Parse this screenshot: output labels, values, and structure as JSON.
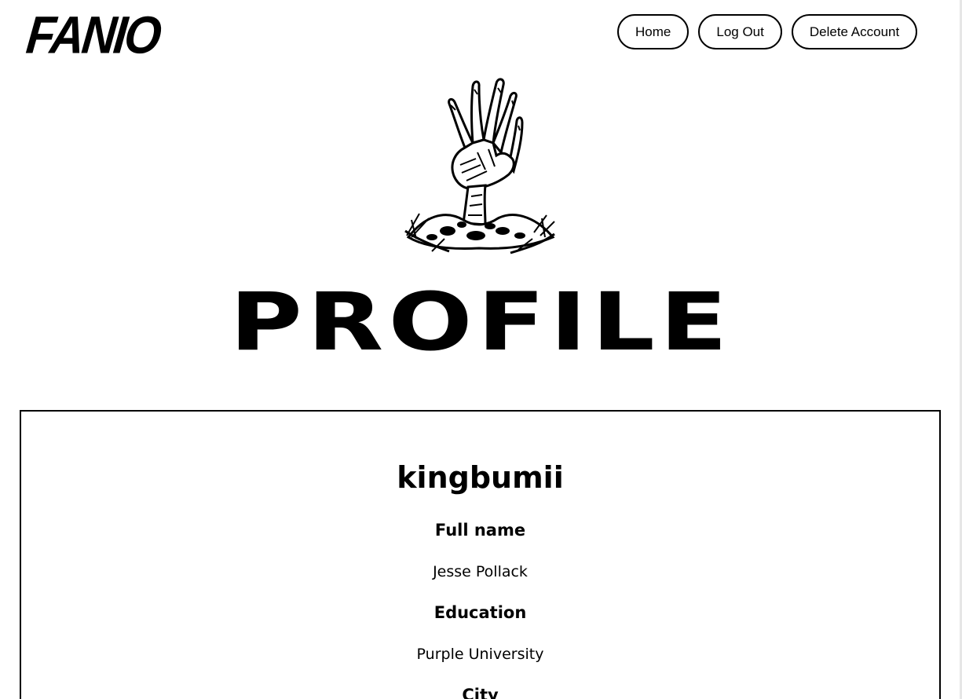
{
  "header": {
    "logo": "FANIO",
    "nav": [
      "Home",
      "Log Out",
      "Delete Account"
    ]
  },
  "page_title": "PROFILE",
  "profile": {
    "username": "kingbumii",
    "fields": [
      {
        "label": "Full name",
        "value": "Jesse Pollack"
      },
      {
        "label": "Education",
        "value": "Purple University"
      },
      {
        "label": "City",
        "value": ""
      }
    ]
  },
  "icons": {
    "hero": "zombie-hand-icon"
  }
}
